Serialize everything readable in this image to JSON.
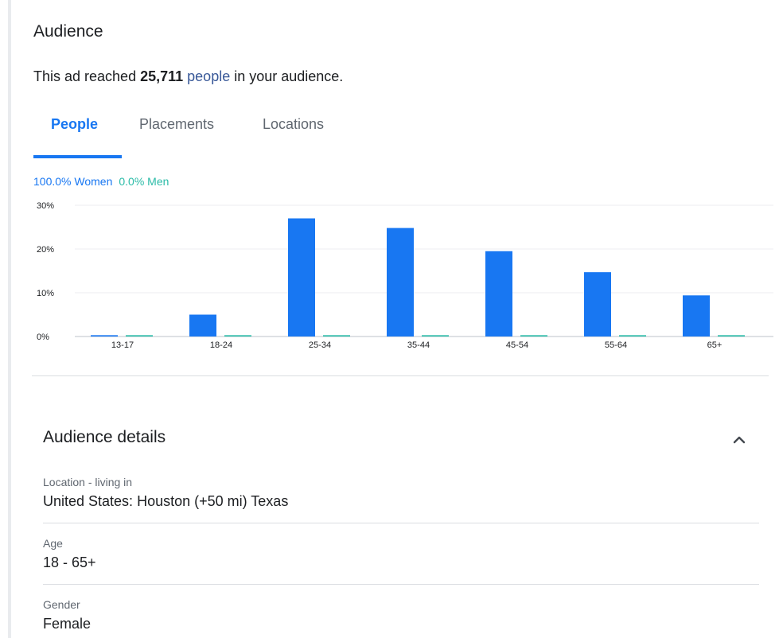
{
  "audience": {
    "title": "Audience",
    "reach_prefix": "This ad reached ",
    "reach_count": "25,711",
    "reach_link": "people",
    "reach_suffix": " in your audience."
  },
  "tabs": [
    {
      "label": "People",
      "active": true
    },
    {
      "label": "Placements",
      "active": false
    },
    {
      "label": "Locations",
      "active": false
    }
  ],
  "legend": {
    "women": "100.0% Women",
    "men": "0.0% Men"
  },
  "colors": {
    "accent": "#1877f2",
    "men": "#2abba7"
  },
  "chart_data": {
    "type": "bar",
    "categories": [
      "13-17",
      "18-24",
      "25-34",
      "35-44",
      "45-54",
      "55-64",
      "65+"
    ],
    "series": [
      {
        "name": "Women",
        "values": [
          0.3,
          5,
          27,
          24.8,
          19.5,
          14.7,
          9.4
        ]
      },
      {
        "name": "Men",
        "values": [
          0.3,
          0.3,
          0.3,
          0.3,
          0.3,
          0.3,
          0.3
        ]
      }
    ],
    "ylim": [
      0,
      30
    ],
    "ytick_labels": [
      "0%",
      "10%",
      "20%",
      "30%"
    ],
    "yticks": [
      0,
      10,
      20,
      30
    ],
    "grid": true,
    "xlabel": "",
    "ylabel": ""
  },
  "details": {
    "title": "Audience details",
    "items": [
      {
        "label": "Location - living in",
        "value": "United States: Houston (+50 mi) Texas"
      },
      {
        "label": "Age",
        "value": "18 - 65+"
      },
      {
        "label": "Gender",
        "value": "Female"
      }
    ]
  }
}
